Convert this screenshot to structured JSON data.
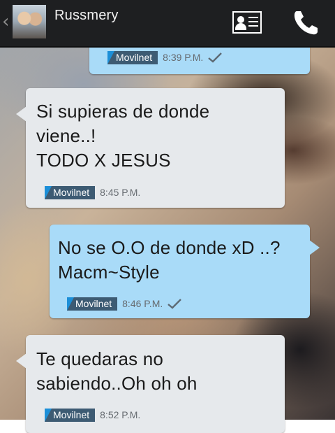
{
  "header": {
    "back_icon": "chevron-left-icon",
    "contact_name": "Russmery",
    "contact_card_icon": "contact-card-icon",
    "call_icon": "phone-icon"
  },
  "colors": {
    "header_bg": "#1e1f21",
    "incoming_bubble": "#e6e9ec",
    "outgoing_bubble": "#a9dbf8",
    "carrier_badge": "#3d5b73",
    "carrier_corner": "#1c8fd8",
    "check": "#5d6a74"
  },
  "messages": [
    {
      "direction": "outgoing",
      "text": "",
      "carrier": "Movilnet",
      "time": "8:39 P.M.",
      "delivered": true
    },
    {
      "direction": "incoming",
      "text": "Si supieras de donde\nviene..!\nTODO X JESUS",
      "carrier": "Movilnet",
      "time": "8:45 P.M.",
      "delivered": false
    },
    {
      "direction": "outgoing",
      "text": "No se O.O de donde xD ..?\nMacm~Style",
      "carrier": "Movilnet",
      "time": "8:46 P.M.",
      "delivered": true
    },
    {
      "direction": "incoming",
      "text": "Te quedaras no\nsabiendo..Oh oh oh",
      "carrier": "Movilnet",
      "time": "8:52 P.M.",
      "delivered": false
    }
  ]
}
